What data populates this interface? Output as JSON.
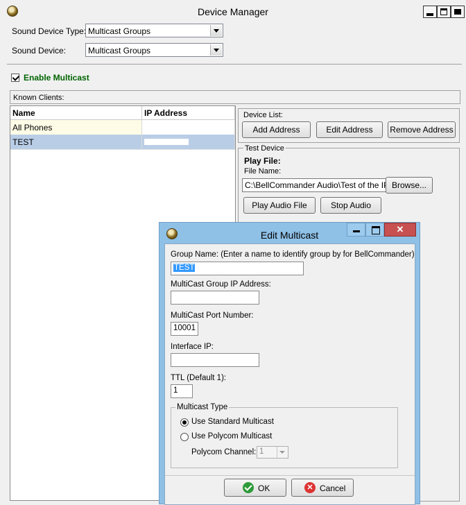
{
  "main_window": {
    "title": "Device Manager",
    "sound_device_type": {
      "label": "Sound Device Type:",
      "value": "Multicast Groups"
    },
    "sound_device": {
      "label": "Sound Device:",
      "value": "Multicast Groups"
    },
    "enable_multicast": {
      "label": "Enable Multicast",
      "checked": true
    },
    "known_clients": {
      "label": "Known Clients:",
      "columns": [
        "Name",
        "IP Address"
      ],
      "rows": [
        {
          "name": "All Phones",
          "ip": ""
        },
        {
          "name": "TEST",
          "ip": "",
          "selected": true
        }
      ]
    },
    "device_list": {
      "label": "Device List:",
      "add_label": "Add Address",
      "edit_label": "Edit Address",
      "remove_label": "Remove Address"
    },
    "test_device": {
      "label": "Test Device",
      "play_file_label": "Play File:",
      "file_name_label": "File Name:",
      "file_name_value": "C:\\BellCommander Audio\\Test of the IP cla",
      "browse_label": "Browse...",
      "play_label": "Play Audio File",
      "stop_label": "Stop Audio"
    }
  },
  "edit_multicast": {
    "title": "Edit Multicast",
    "group_name": {
      "label": "Group Name: (Enter a name to identify group by for BellCommander)",
      "value": "TEST"
    },
    "multicast_ip": {
      "label": "MultiCast Group IP Address:",
      "value": ""
    },
    "port": {
      "label": "MultiCast Port Number:",
      "value": "10001"
    },
    "interface_ip": {
      "label": "Interface IP:",
      "value": ""
    },
    "ttl": {
      "label": "TTL (Default 1):",
      "value": "1"
    },
    "multicast_type": {
      "label": "Multicast Type",
      "standard_label": "Use Standard Multicast",
      "polycom_label": "Use Polycom Multicast",
      "selected": "standard",
      "polycom_channel_label": "Polycom Channel:",
      "polycom_channel_value": "1"
    },
    "ok_label": "OK",
    "cancel_label": "Cancel"
  },
  "colors": {
    "dialog_frame": "#8fc0e6",
    "close_button": "#c75050",
    "enable_multicast_text": "#006400",
    "selected_row": "#b9cde6",
    "first_row": "#fefce6",
    "text_selection": "#3399ff"
  }
}
